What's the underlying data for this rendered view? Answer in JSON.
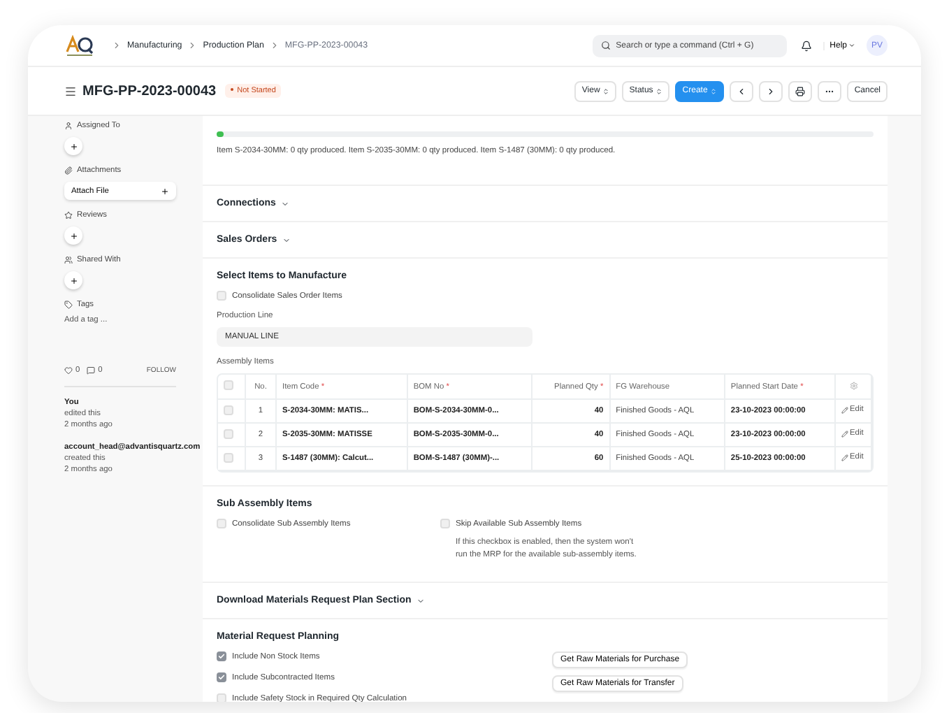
{
  "navbar": {
    "breadcrumbs": [
      "Manufacturing",
      "Production Plan",
      "MFG-PP-2023-00043"
    ],
    "search": {
      "placeholder": "Search or type a command (Ctrl + G)"
    },
    "help": "Help",
    "avatar": "PV"
  },
  "header": {
    "title": "MFG-PP-2023-00043",
    "status": "Not Started",
    "buttons": [
      {
        "kind": "dropdown",
        "label": "View"
      },
      {
        "kind": "dropdown",
        "label": "Status"
      },
      {
        "kind": "primary",
        "label": "Create"
      },
      {
        "kind": "prev"
      },
      {
        "kind": "next"
      },
      {
        "kind": "print"
      },
      {
        "kind": "more"
      },
      {
        "kind": "plain",
        "label": "Cancel"
      }
    ]
  },
  "sidebar": {
    "sections": [
      {
        "kind": "assign",
        "title": "Assigned To"
      },
      {
        "kind": "attach",
        "title": "Attachments",
        "button": "Attach File"
      },
      {
        "kind": "review",
        "title": "Reviews"
      },
      {
        "kind": "share",
        "title": "Shared With"
      },
      {
        "kind": "tags",
        "title": "Tags",
        "link": "Add a tag ..."
      }
    ],
    "likes": "0",
    "comments": "0",
    "follow": "FOLLOW",
    "activity": [
      {
        "actor": "You",
        "action": "edited this",
        "time": "2 months ago"
      },
      {
        "actor": "account_head@advantisquartz.com",
        "action": "created this",
        "time": "2 months ago"
      }
    ]
  },
  "progress": {
    "level": 0.01,
    "text": "Item S-2034-30MM: 0 qty produced. Item S-2035-30MM: 0 qty produced. Item S-1487 (30MM): 0 qty produced."
  },
  "collapsed_sections": [
    {
      "title": "Connections",
      "expanded": false
    },
    {
      "title": "Sales Orders",
      "expanded": false
    }
  ],
  "select_items": {
    "title": "Select Items to Manufacture",
    "checkbox": {
      "label": "Consolidate Sales Order Items",
      "checked": false
    },
    "production_line": {
      "label": "Production Line",
      "value": "MANUAL LINE"
    },
    "table": {
      "label": "Assembly Items",
      "select_all": {
        "checked": false
      },
      "columns": [
        {
          "label": "No."
        },
        {
          "label": "Item Code",
          "mark": "*"
        },
        {
          "label": "BOM No",
          "mark": "*"
        },
        {
          "label": "Planned Qty",
          "mark": "*"
        },
        {
          "label": "FG Warehouse"
        },
        {
          "label": "Planned Start Date",
          "mark": "*"
        }
      ],
      "rows": [
        {
          "selected": false,
          "cells": [
            "1",
            "S-2034-30MM: MATIS...",
            "BOM-S-2034-30MM-0...",
            "40",
            "Finished Goods - AQL",
            "23-10-2023 00:00:00"
          ],
          "action": "Edit"
        },
        {
          "selected": false,
          "cells": [
            "2",
            "S-2035-30MM: MATISSE",
            "BOM-S-2035-30MM-0...",
            "40",
            "Finished Goods - AQL",
            "23-10-2023 00:00:00"
          ],
          "action": "Edit"
        },
        {
          "selected": false,
          "cells": [
            "3",
            "S-1487 (30MM): Calcut...",
            "BOM-S-1487 (30MM)-...",
            "60",
            "Finished Goods - AQL",
            "25-10-2023 00:00:00"
          ],
          "action": "Edit"
        }
      ]
    }
  },
  "sub_assembly": {
    "title": "Sub Assembly Items",
    "checkboxes": [
      {
        "label": "Consolidate Sub Assembly Items",
        "checked": false
      },
      {
        "label": "Skip Available Sub Assembly Items",
        "checked": false,
        "help": "If this checkbox is enabled, then the system won't run the MRP for the available sub-assembly items."
      }
    ]
  },
  "download_section": {
    "title": "Download Materials Request Plan Section",
    "expanded": false
  },
  "material_request": {
    "title": "Material Request Planning",
    "checkboxes": [
      {
        "label": "Include Non Stock Items",
        "checked": true
      },
      {
        "label": "Include Subcontracted Items",
        "checked": true
      },
      {
        "label": "Include Safety Stock in Required Qty Calculation",
        "checked": false
      }
    ],
    "buttons": [
      "Get Raw Materials for Purchase",
      "Get Raw Materials for Transfer"
    ]
  }
}
